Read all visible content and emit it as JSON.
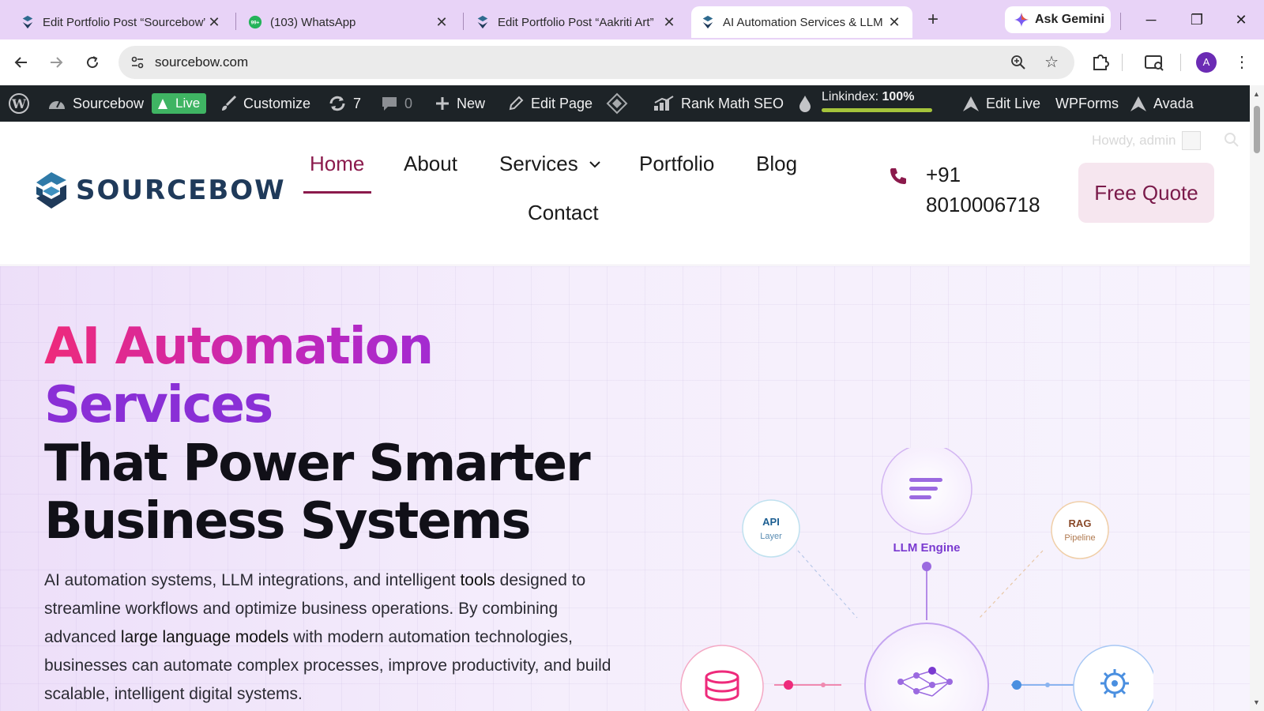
{
  "browser": {
    "tabs": [
      {
        "title": "Edit Portfolio Post “Sourcebow”",
        "favicon": "sourcebow-favicon",
        "active": false
      },
      {
        "title": "(103) WhatsApp",
        "favicon": "whatsapp-favicon",
        "badge": "99+",
        "active": false
      },
      {
        "title": "Edit Portfolio Post “Aakriti Art”",
        "favicon": "sourcebow-favicon",
        "active": false
      },
      {
        "title": "AI Automation Services & LLM",
        "favicon": "sourcebow-favicon",
        "active": true
      }
    ],
    "new_tab": "+",
    "gemini_label": "Ask Gemini",
    "window_controls": {
      "minimize": "─",
      "restore": "❐",
      "close": "✕"
    },
    "url": "sourcebow.com",
    "profile_initial": "A",
    "tab_strip_color": "#e8d3f7"
  },
  "admin_bar": {
    "site_name": "Sourcebow",
    "live_label": "Live",
    "customize": "Customize",
    "updates_count": "7",
    "comments_count": "0",
    "new_label": "New",
    "edit_page": "Edit Page",
    "rank_math": "Rank Math SEO",
    "linkindex_label": "Linkindex:",
    "linkindex_value": "100%",
    "linkindex_progress": 1.0,
    "edit_live": "Edit Live",
    "wpforms": "WPForms",
    "avada": "Avada"
  },
  "header": {
    "howdy": "Howdy, admin",
    "logo_text": "SOURCEBOW",
    "menu": {
      "home": "Home",
      "about": "About",
      "services": "Services",
      "portfolio": "Portfolio",
      "blog": "Blog",
      "contact": "Contact"
    },
    "phone_line1": "+91",
    "phone_line2": "8010006718",
    "cta": "Free Quote",
    "accent_color": "#8b1a4c"
  },
  "hero": {
    "title_line1": "AI Automation",
    "title_line2": "Services",
    "title_line3": "That Power Smarter",
    "title_line4": "Business Systems",
    "lead_part1": "AI automation systems, LLM integrations, and intelligent ",
    "lead_link1": "tools",
    "lead_part2": " designed to streamline workflows and optimize business operations. By combining advanced ",
    "lead_link2": "large language models",
    "lead_part3": " with modern automation technologies, businesses can automate complex processes, improve productivity, and build scalable, intelligent digital systems.",
    "diagram": {
      "api_title": "API",
      "api_sub": "Layer",
      "llm_label": "LLM Engine",
      "rag_title": "RAG",
      "rag_sub": "Pipeline"
    }
  }
}
